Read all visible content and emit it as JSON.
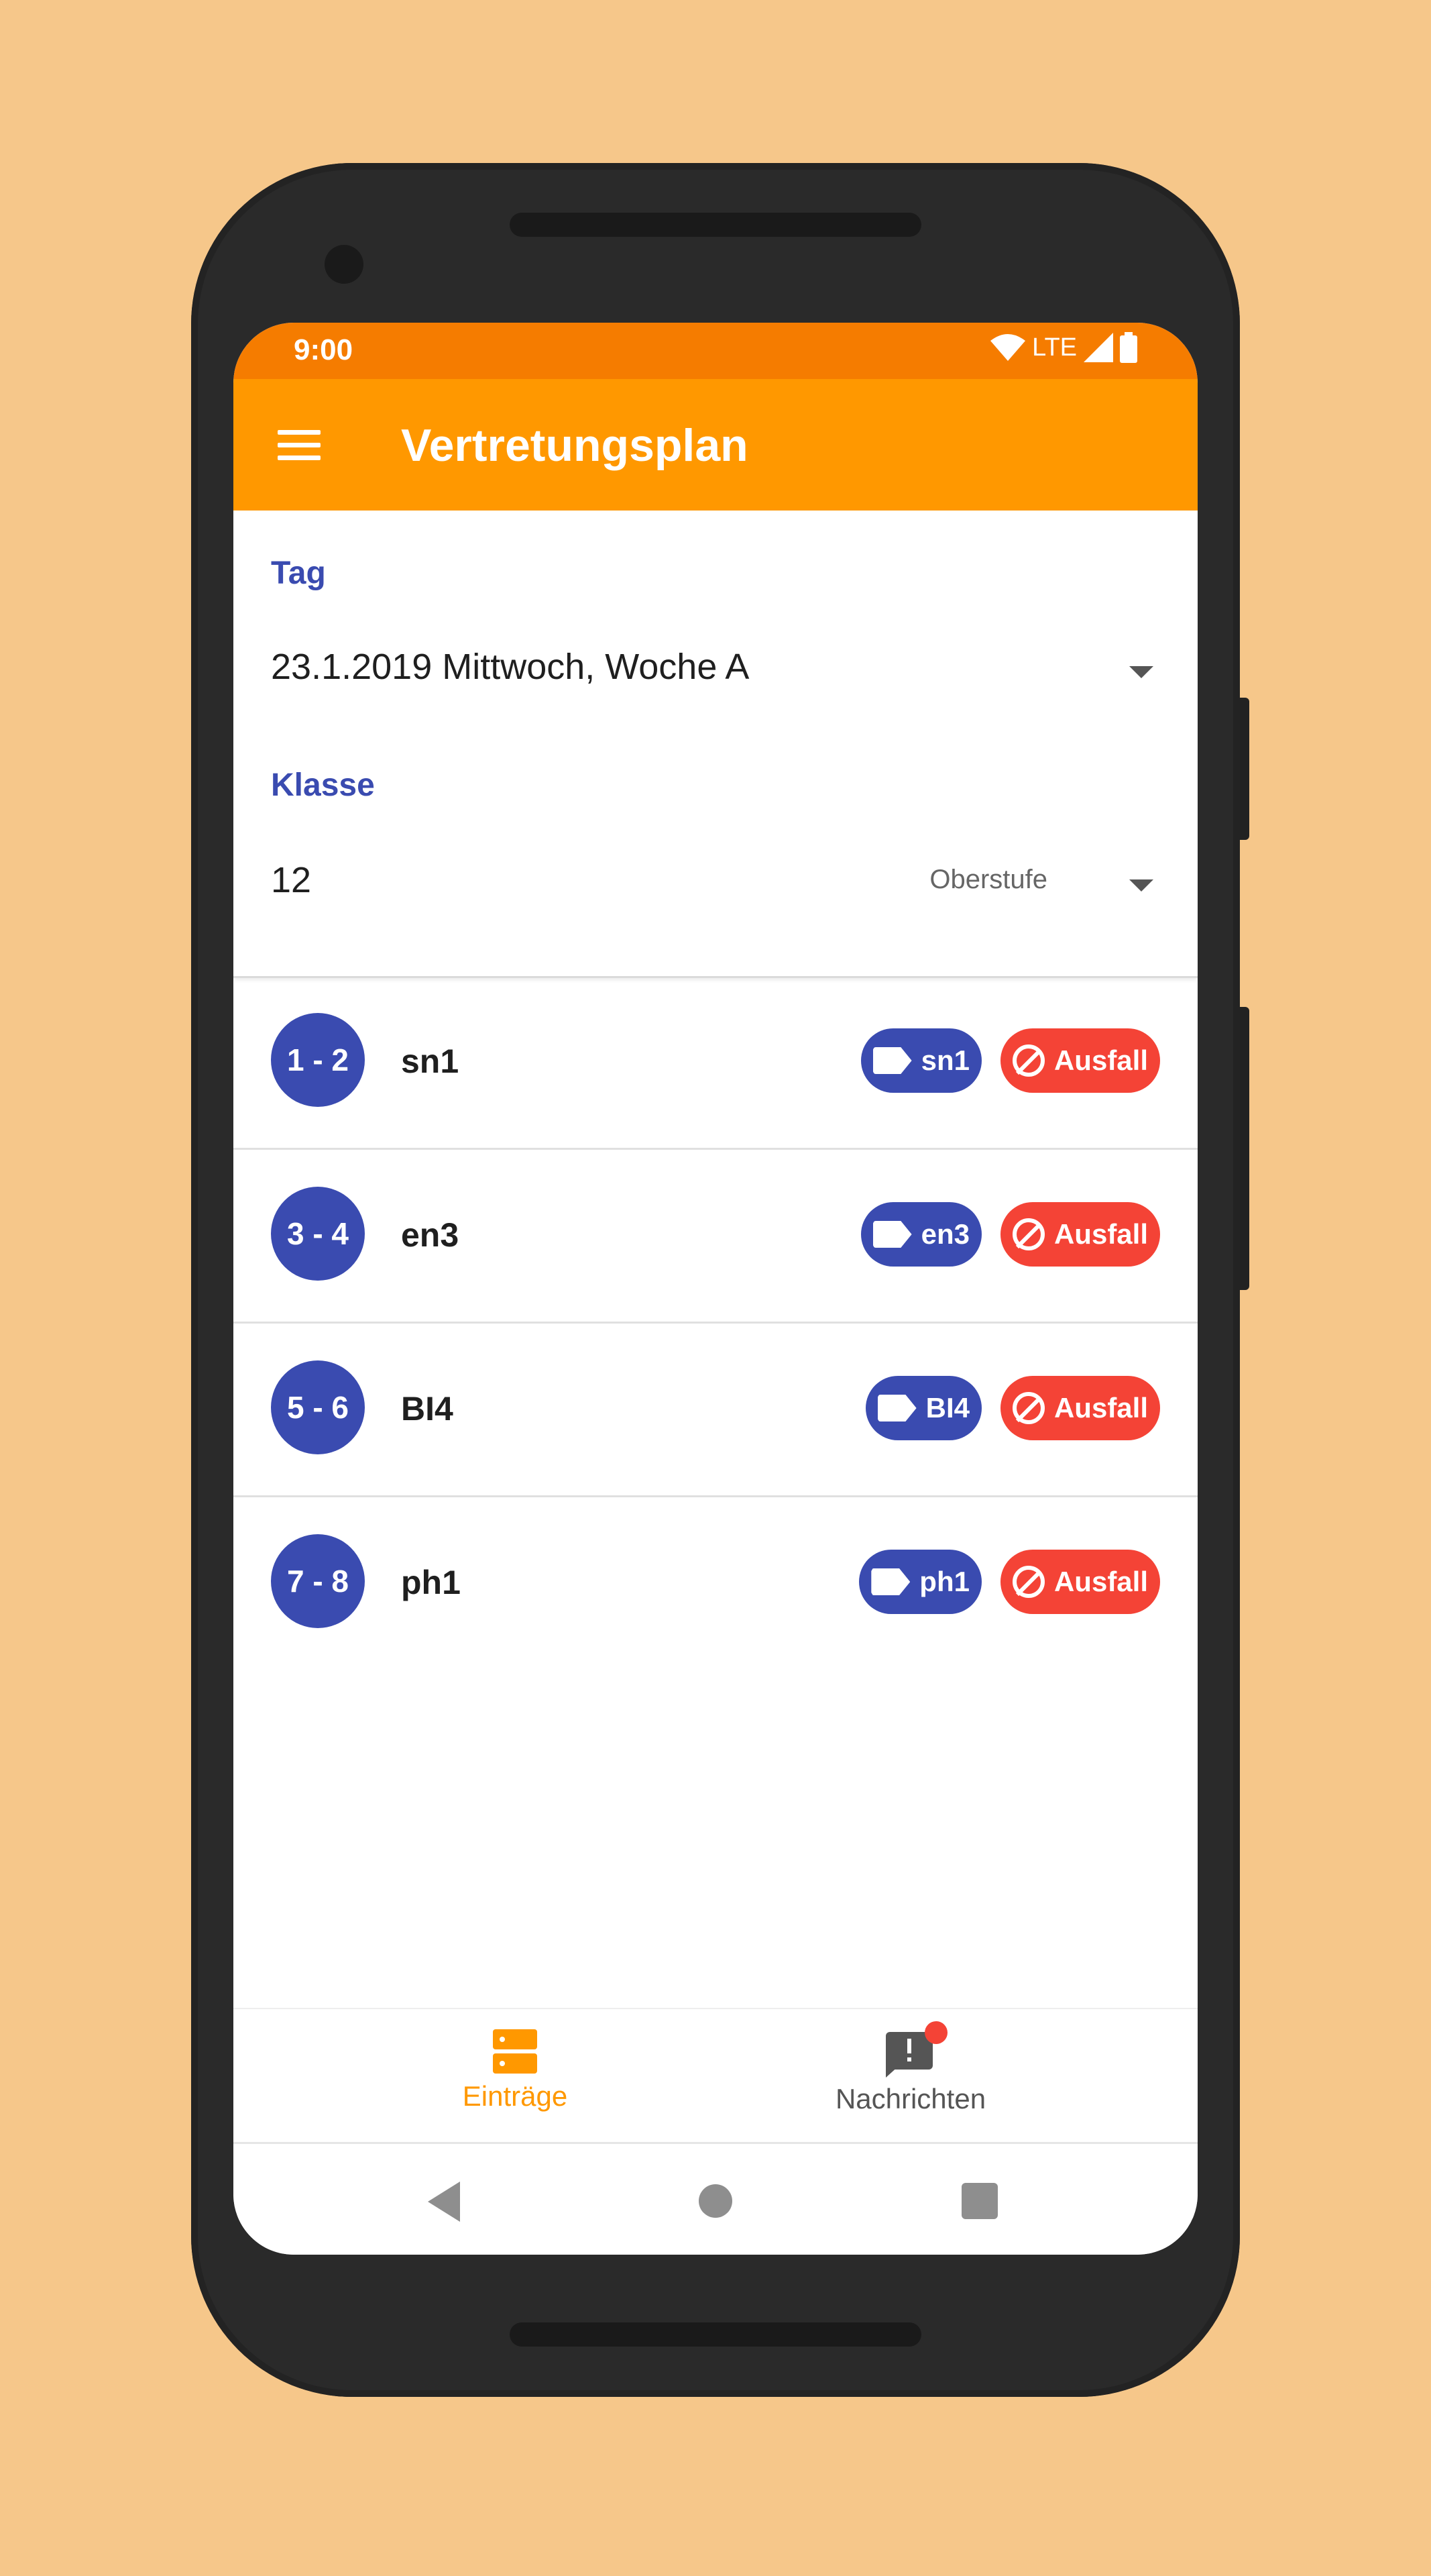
{
  "status_bar": {
    "time": "9:00",
    "network": "LTE"
  },
  "app_bar": {
    "title": "Vertretungsplan"
  },
  "filters": {
    "day": {
      "label": "Tag",
      "value": "23.1.2019 Mittwoch, Woche A"
    },
    "class": {
      "label": "Klasse",
      "value": "12",
      "hint": "Oberstufe"
    }
  },
  "entries": [
    {
      "period": "1 - 2",
      "subject": "sn1",
      "tag": "sn1",
      "status": "Ausfall"
    },
    {
      "period": "3 - 4",
      "subject": "en3",
      "tag": "en3",
      "status": "Ausfall"
    },
    {
      "period": "5 - 6",
      "subject": "BI4",
      "tag": "BI4",
      "status": "Ausfall"
    },
    {
      "period": "7 - 8",
      "subject": "ph1",
      "tag": "ph1",
      "status": "Ausfall"
    }
  ],
  "bottom_nav": {
    "items": [
      {
        "label": "Einträge",
        "icon": "entries-icon",
        "active": true
      },
      {
        "label": "Nachrichten",
        "icon": "message-alert-icon",
        "active": false,
        "badge": true
      }
    ]
  },
  "colors": {
    "primary": "#FF9800",
    "primary_dark": "#F57C00",
    "accent": "#3A4BB0",
    "cancel": "#F44336",
    "background": "#F6C78A"
  }
}
